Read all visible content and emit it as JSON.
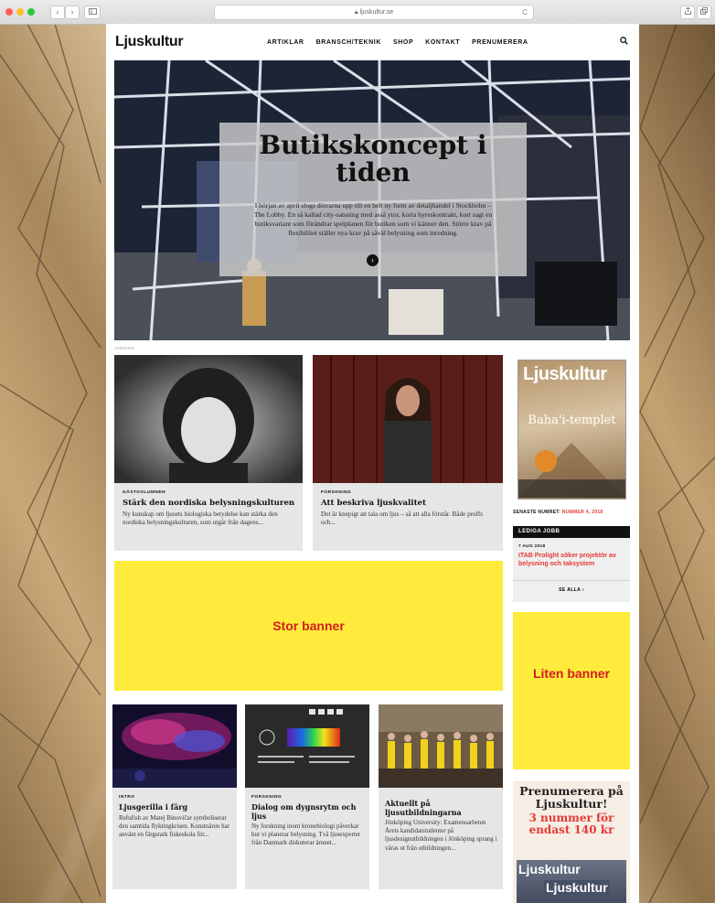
{
  "browser": {
    "url": "ljuskultur.se",
    "back_label": "‹",
    "forward_label": "›",
    "reload_label": "C"
  },
  "site": {
    "logo": "Ljuskultur",
    "nav": [
      "ARTIKLAR",
      "BRANSCH/TEKNIK",
      "SHOP",
      "KONTAKT",
      "PRENUMERERA"
    ],
    "search_icon": "search-icon"
  },
  "hero": {
    "title": "Butikskoncept i tiden",
    "text": "I början av april slogs dörrarna upp till en helt ny form av detaljhandel i Stockholm – The Lobby. En så kallad city-satsning med asså ytor, korta hyreskontrakt, kort sagt en butiksvariant som förändrar spelplanen för butiken som vi känner den. Större krav på flexibilitet ställer nya krav på såväl belysning som inredning.",
    "next_icon": "arrow-right-icon",
    "next_label": "›"
  },
  "ad_label": "ANNONS",
  "articles": [
    {
      "category": "GÄSTKOLUMNEN",
      "title": "Stärk den nordiska belysningskulturen",
      "desc": "Ny kunskap om ljusets biologiska betydelse kan stärka den nordiska belysningskulturen, som utgår från dagens..."
    },
    {
      "category": "FORSKNING",
      "title": "Att beskriva ljuskvalitet",
      "desc": "Det är knepigt att tala om ljus – så att alla förstår. Både proffs och..."
    },
    {
      "category": "INTRO",
      "title": "Ljusgerilla i färg",
      "desc": "Refufish av Matej Binovičar symboliserar den samtida flyktingkrisen. Konstnären har använt en färgstark fiskeskola för..."
    },
    {
      "category": "FORSKNING",
      "title": "Dialog om dygnsrytm och ljus",
      "desc": "Ny forskning inom kronobiologi påverkar hur vi planerar belysning. Två ljusexperter från Danmark diskuterar ämnet..."
    },
    {
      "category": "",
      "title": "Aktuellt på ljusutbildningarna",
      "desc": "Jönköping University: Examensarbeten Årets kandidatstudenter på ljusdesignutbildningen i Jönköping sprang i våras ut från utbildningen..."
    }
  ],
  "magazine": {
    "cover_title": "Ljuskultur",
    "cover_headline": "Baha'i-templet",
    "latest_label": "SENASTE NUMRET:",
    "latest_issue": "NUMMER 4, 2018"
  },
  "jobs": {
    "header": "LEDIGA JOBB",
    "date": "7 AUG 2018",
    "title": "ITAB Prolight söker projektör av belysning och taksystem",
    "see_all": "SE ALLA"
  },
  "banners": {
    "big": "Stor banner",
    "small": "Liten banner"
  },
  "subscribe_ad": {
    "line1": "Prenumerera på Ljuskultur!",
    "line2": "3 nummer för endast 140 kr",
    "mag_name": "Ljuskultur"
  },
  "colors": {
    "banner_bg": "#ffeb3b",
    "banner_text": "#d21f1f",
    "accent_red": "#e53935"
  }
}
